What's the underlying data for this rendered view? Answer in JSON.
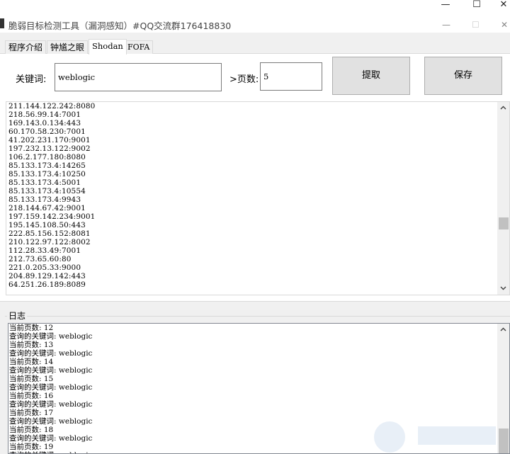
{
  "window": {
    "title": "脆弱目标检测工具（漏洞感知）#QQ交流群176418830",
    "app_icon": "app-icon",
    "minimize": "—",
    "maximize": "☐",
    "close": "✕"
  },
  "tabs": [
    {
      "label": "程序介绍",
      "active": false
    },
    {
      "label": "钟馗之眼",
      "active": false
    },
    {
      "label": "Shodan",
      "active": true
    },
    {
      "label": "FOFA",
      "active": false
    }
  ],
  "shodan": {
    "keyword_label": "关键词:",
    "keyword_value": "weblogic",
    "pages_label": ">页数:",
    "pages_value": "5",
    "fetch_label": "提取",
    "save_label": "保存",
    "results": [
      "211.144.122.242:8080",
      "218.56.99.14:7001",
      "169.143.0.134:443",
      "60.170.58.230:7001",
      "41.202.231.170:9001",
      "197.232.13.122:9002",
      "106.2.177.180:8080",
      "85.133.173.4:14265",
      "85.133.173.4:10250",
      "85.133.173.4:5001",
      "85.133.173.4:10554",
      "85.133.173.4:9943",
      "218.144.67.42:9001",
      "197.159.142.234:9001",
      "195.145.108.50:443",
      "222.85.156.152:8081",
      "210.122.97.122:8002",
      "112.28.33.49:7001",
      "212.73.65.60:80",
      "221.0.205.33:9000",
      "204.89.129.142:443",
      "64.251.26.189:8089"
    ]
  },
  "log": {
    "title": "日志",
    "lines": [
      "当前页数: 12",
      "查询的关键词: weblogic",
      "当前页数: 13",
      "查询的关键词: weblogic",
      "当前页数: 14",
      "查询的关键词: weblogic",
      "当前页数: 15",
      "查询的关键词: weblogic",
      "当前页数: 16",
      "查询的关键词: weblogic",
      "当前页数: 17",
      "查询的关键词: weblogic",
      "当前页数: 18",
      "查询的关键词: weblogic",
      "当前页数: 19",
      "查询的关键词: weblogic"
    ]
  },
  "icons": {
    "scroll_up": "chevron-up-icon",
    "scroll_down": "chevron-down-icon"
  },
  "colors": {
    "window_bg": "#f0f0f0",
    "button_bg": "#e1e1e1",
    "border": "#adadad"
  }
}
